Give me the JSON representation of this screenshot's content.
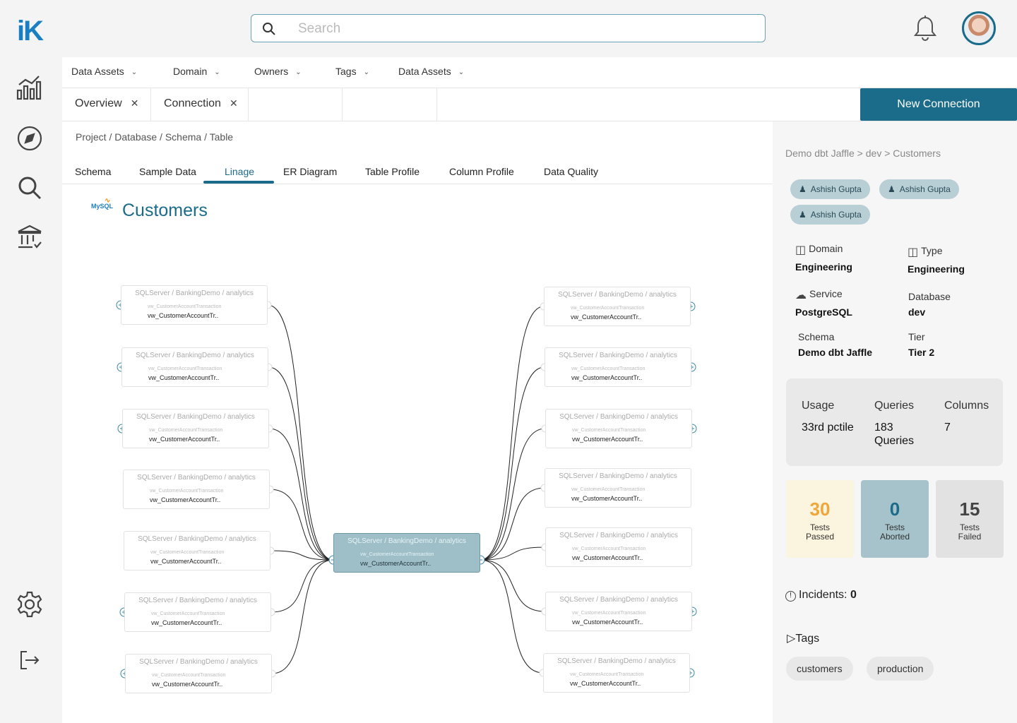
{
  "app": {
    "logo": "iK"
  },
  "search": {
    "placeholder": "Search"
  },
  "filters": [
    {
      "label": "Data Assets"
    },
    {
      "label": "Domain"
    },
    {
      "label": "Owners"
    },
    {
      "label": "Tags"
    },
    {
      "label": "Data Assets"
    }
  ],
  "page_tabs": [
    {
      "label": "Overview"
    },
    {
      "label": "Connection"
    }
  ],
  "new_connection_label": "New Connection",
  "breadcrumb": "Project / Database / Schema / Table",
  "subtabs": [
    {
      "label": "Schema"
    },
    {
      "label": "Sample Data"
    },
    {
      "label": "Linage"
    },
    {
      "label": "ER Diagram"
    },
    {
      "label": "Table Profile"
    },
    {
      "label": "Column Profile"
    },
    {
      "label": "Data Quality"
    }
  ],
  "entity": {
    "source": "MySQL",
    "title": "Customers"
  },
  "lineage": {
    "node_path": "SQLServer / BankingDemo / analytics",
    "node_full": "vw_CustomerAccountTransaction",
    "node_short": "vw_CustomerAccountTr.."
  },
  "details": {
    "crumb": "Demo dbt Jaffle > dev > Customers",
    "owners": [
      "Ashish Gupta",
      "Ashish Gupta",
      "Ashish Gupta"
    ],
    "domain": {
      "label": "Domain",
      "value": "Engineering"
    },
    "type": {
      "label": "Type",
      "value": "Engineering"
    },
    "service": {
      "label": "Service",
      "value": "PostgreSQL"
    },
    "database": {
      "label": "Database",
      "value": "dev"
    },
    "schema": {
      "label": "Schema",
      "value": "Demo dbt Jaffle"
    },
    "tier": {
      "label": "Tier",
      "value": "Tier 2"
    },
    "usage": {
      "label": "Usage",
      "value": "33rd pctile"
    },
    "queries": {
      "label": "Queries",
      "value": "183 Queries"
    },
    "columns": {
      "label": "Columns",
      "value": "7"
    },
    "tests": {
      "passed": {
        "count": "30",
        "label": "Tests Passed",
        "color": "#f0a63a"
      },
      "aborted": {
        "count": "0",
        "label": "Tests Aborted",
        "color": "#1b6b8a"
      },
      "failed": {
        "count": "15",
        "label": "Tests Failed",
        "color": "#444444"
      }
    },
    "incidents_label": "Incidents:",
    "incidents_count": "0",
    "tags_label": "Tags",
    "tags": [
      "customers",
      "production"
    ]
  },
  "colors": {
    "accent": "#1b6b8a",
    "logo": "#1a7fc1"
  }
}
